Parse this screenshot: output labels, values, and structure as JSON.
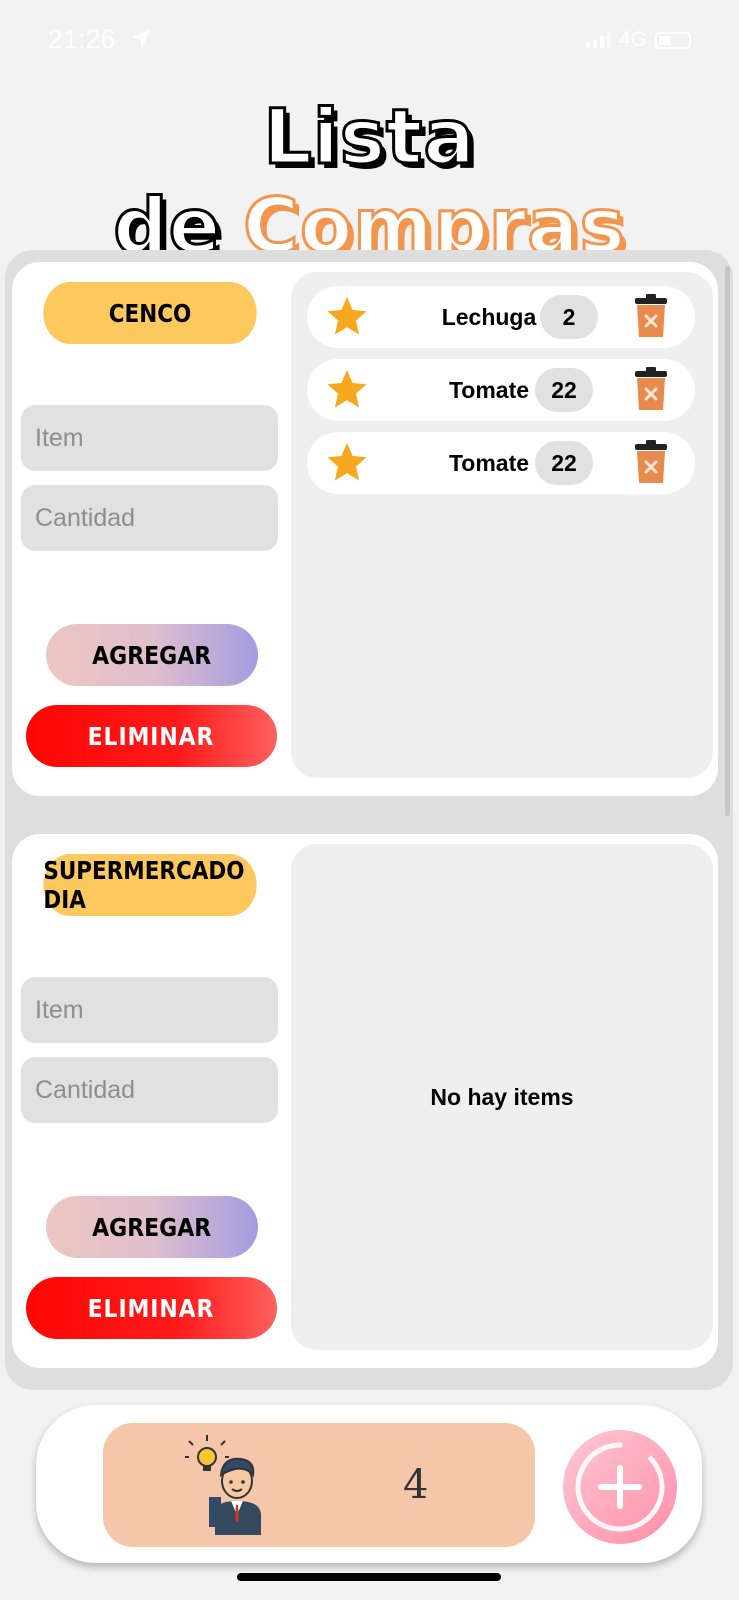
{
  "status_bar": {
    "time": "21:26",
    "network": "4G"
  },
  "header": {
    "title_part1": "Lista de",
    "title_part2": "Compras"
  },
  "lists": [
    {
      "store": "CENCO",
      "item_placeholder": "Item",
      "qty_placeholder": "Cantidad",
      "add_label": "AGREGAR",
      "delete_label": "ELIMINAR",
      "items": [
        {
          "name": "Lechuga",
          "qty": "2"
        },
        {
          "name": "Tomate",
          "qty": "22"
        },
        {
          "name": "Tomate",
          "qty": "22"
        }
      ]
    },
    {
      "store": "SUPERMERCADO DIA",
      "item_placeholder": "Item",
      "qty_placeholder": "Cantidad",
      "add_label": "AGREGAR",
      "delete_label": "ELIMINAR",
      "empty_message": "No hay items",
      "items": []
    }
  ],
  "footer": {
    "count": "4"
  },
  "colors": {
    "badge": "#fdc85e",
    "delete": "#ff0505",
    "accent_orange": "#f3964d",
    "star": "#f8a81e",
    "trash": "#e88a4e",
    "counter_bg": "#f5c6aa",
    "fab": "#ff8fa8"
  },
  "icons": [
    "location-arrow-icon",
    "signal-icon",
    "battery-icon",
    "star-icon",
    "trash-icon",
    "avatar-icon",
    "plus-icon"
  ]
}
